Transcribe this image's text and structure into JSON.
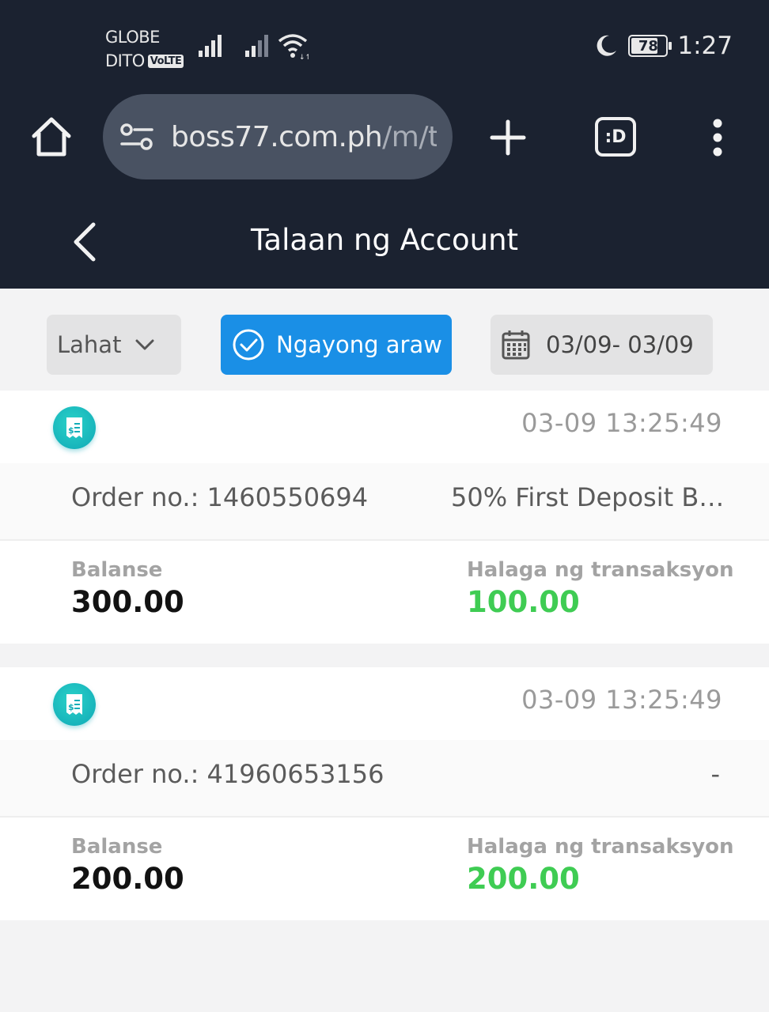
{
  "status_bar": {
    "carrier_1": "GLOBE",
    "carrier_2": "DITO",
    "volte_badge": "VoLTE",
    "battery": "78",
    "battery_level": 0.78,
    "time": "1:27"
  },
  "browser": {
    "url_main": "boss77.com.ph",
    "url_path": "/m/tra"
  },
  "header": {
    "title": "Talaan ng Account"
  },
  "filters": {
    "type_label": "Lahat",
    "today_label": "Ngayong araw",
    "date_range": "03/09- 03/09"
  },
  "records": [
    {
      "time": "03-09 13:25:49",
      "order": "Order no.: 1460550694",
      "description": "50% First Deposit B…",
      "balance_label": "Balanse",
      "balance": "300.00",
      "amount_label": "Halaga ng transaksyon",
      "amount": "100.00"
    },
    {
      "time": "03-09 13:25:49",
      "order": "Order no.: 41960653156",
      "description": "-",
      "balance_label": "Balanse",
      "balance": "200.00",
      "amount_label": "Halaga ng transaksyon",
      "amount": "200.00"
    }
  ],
  "colors": {
    "header_bg": "#1b2230",
    "active_filter": "#1a8fe6",
    "amount_green": "#3fcc53",
    "receipt_icon": "#18b9be"
  }
}
